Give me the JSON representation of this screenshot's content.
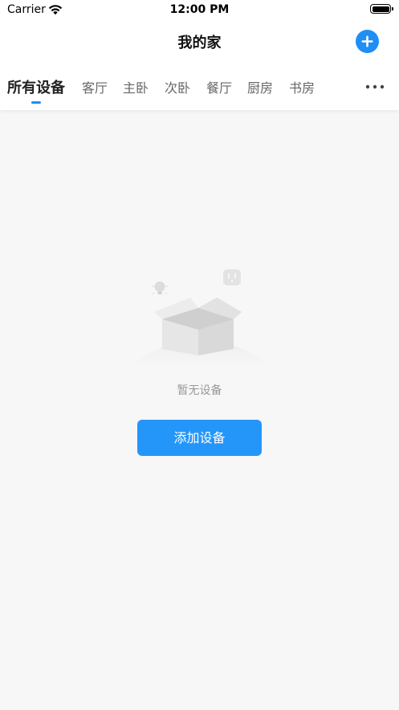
{
  "status_bar": {
    "carrier": "Carrier",
    "time": "12:00 PM"
  },
  "header": {
    "title": "我的家",
    "add_icon": "plus-circle-icon"
  },
  "tabs": [
    {
      "label": "所有设备",
      "active": true
    },
    {
      "label": "客厅"
    },
    {
      "label": "主卧"
    },
    {
      "label": "次卧"
    },
    {
      "label": "餐厅"
    },
    {
      "label": "厨房"
    },
    {
      "label": "书房"
    }
  ],
  "more_icon": "more-horizontal-icon",
  "empty_state": {
    "illustration": "empty-box-icon",
    "message": "暂无设备",
    "button_label": "添加设备"
  },
  "colors": {
    "accent": "#2496fa",
    "background": "#f7f7f7",
    "muted_text": "#999999"
  }
}
